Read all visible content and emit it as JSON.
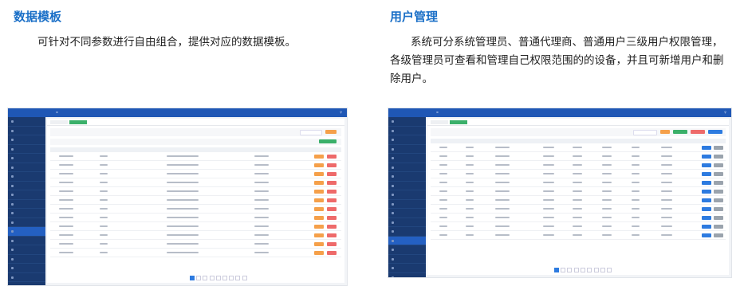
{
  "left": {
    "title": "数据模板",
    "description": "可针对不同参数进行自由组合，提供对应的数据模板。"
  },
  "right": {
    "title": "用户管理",
    "description": "系统可分系统管理员、普通代理商、普通用户三级用户权限管理，各级管理员可查看和管理自己权限范围的的设备，并且可新增用户和删除用户。"
  },
  "colors": {
    "title_blue": "#1a6fc7",
    "sidebar": "#1a3a70",
    "topbar": "#1f57b5",
    "btn_orange": "#f5a04a",
    "btn_red": "#ee6a6a",
    "btn_blue": "#2d7be0",
    "btn_green": "#3bb06a",
    "btn_gray": "#9aa3ad"
  }
}
